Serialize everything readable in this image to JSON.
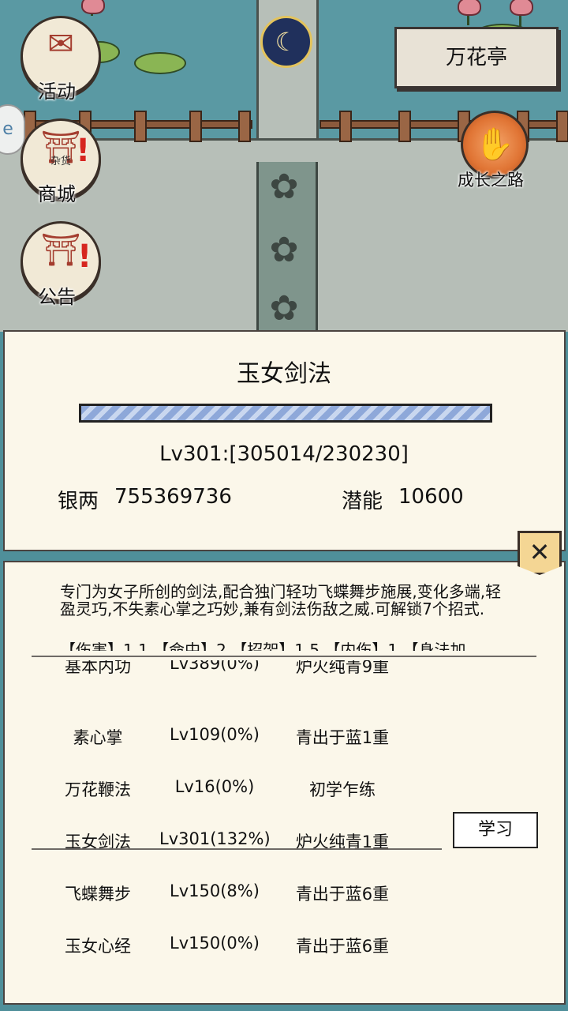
{
  "hud": {
    "activity_label": "活动",
    "shop_label": "商城",
    "notice_label": "公告",
    "location_button": "万花亭",
    "growth_label": "成长之路",
    "shop_sign": "杂货"
  },
  "skill_panel": {
    "title": "玉女剑法",
    "progress_fraction": 1.0,
    "level_text": "Lv301:[305014/230230]",
    "silver_label": "银两",
    "silver_value": "755369736",
    "potential_label": "潜能",
    "potential_value": "10600",
    "close_glyph": "✕"
  },
  "detail_panel": {
    "description": "专门为女子所创的剑法,配合独门轻功飞蝶舞步施展,变化多端,轻盈灵巧,不失素心掌之巧妙,兼有剑法伤敌之威.可解锁7个招式.",
    "stats_partial": "【伤害】1.1 【命中】2 【招架】1.5 【内伤】1 【身法加",
    "partial_row": {
      "name": "基本内功",
      "level": "Lv389(0%)",
      "rank": "炉火纯青9重"
    },
    "skills": [
      {
        "name": "素心掌",
        "level": "Lv109(0%)",
        "rank": "青出于蓝1重"
      },
      {
        "name": "万花鞭法",
        "level": "Lv16(0%)",
        "rank": "初学乍练"
      },
      {
        "name": "玉女剑法",
        "level": "Lv301(132%)",
        "rank": "炉火纯青1重"
      },
      {
        "name": "飞蝶舞步",
        "level": "Lv150(8%)",
        "rank": "青出于蓝6重"
      },
      {
        "name": "玉女心经",
        "level": "Lv150(0%)",
        "rank": "青出于蓝6重"
      }
    ],
    "learn_button": "学习"
  },
  "colors": {
    "panel_bg": "#fbf7ea",
    "water": "#5a99a3",
    "progress_fill": "#8ea8d9",
    "badge_red": "#d6261f"
  }
}
